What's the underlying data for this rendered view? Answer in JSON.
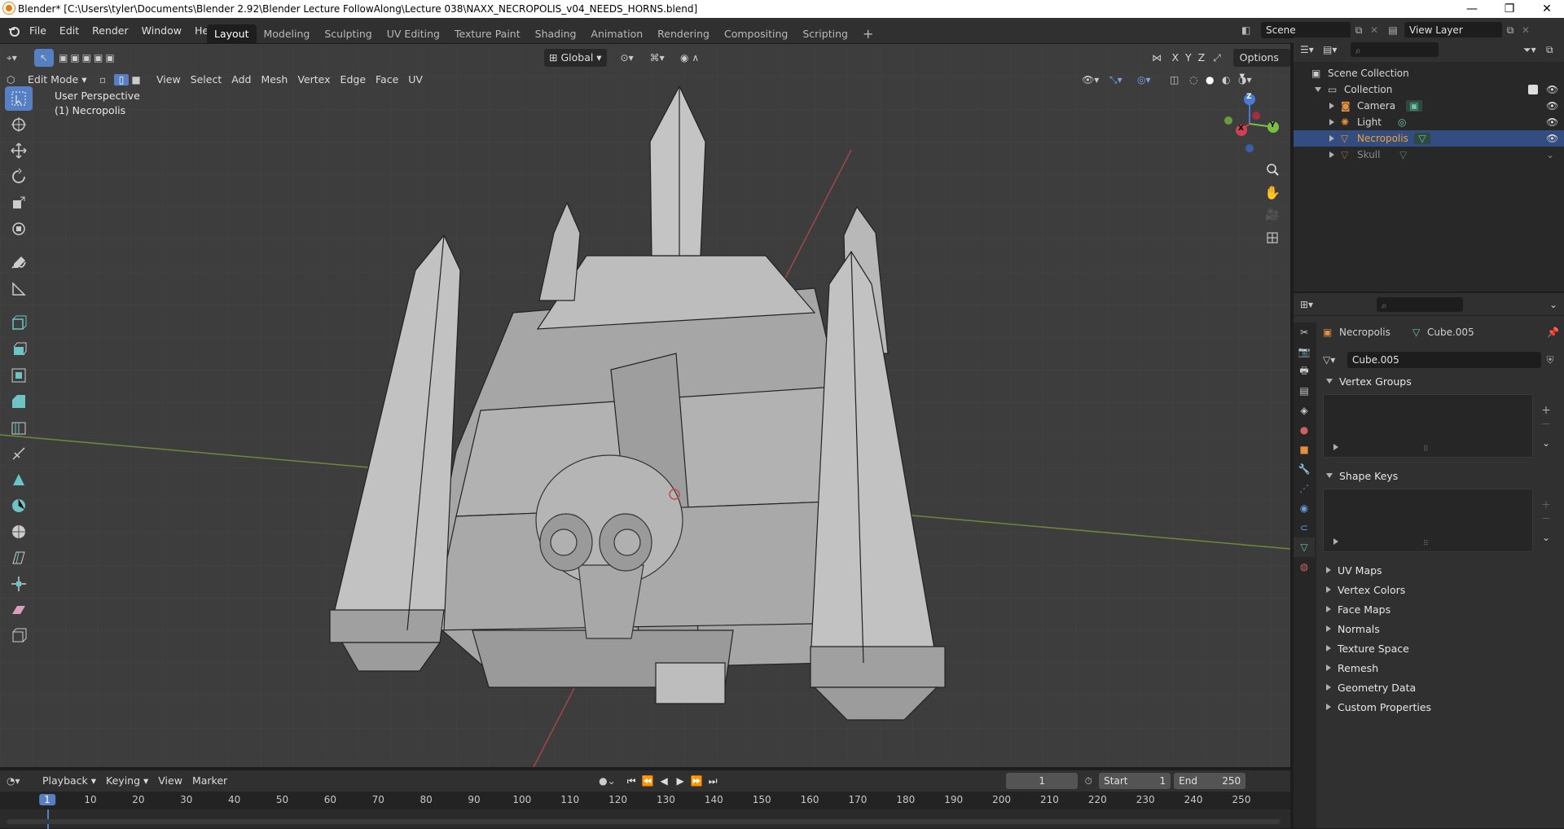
{
  "window": {
    "title": "Blender* [C:\\Users\\tyler\\Documents\\Blender 2.92\\Blender Lecture FollowAlong\\Lecture 038\\NAXX_NECROPOLIS_v04_NEEDS_HORNS.blend]",
    "minimize": "—",
    "restore": "❐",
    "close": "✕"
  },
  "menu": [
    "File",
    "Edit",
    "Render",
    "Window",
    "Help"
  ],
  "workspaces": [
    "Layout",
    "Modeling",
    "Sculpting",
    "UV Editing",
    "Texture Paint",
    "Shading",
    "Animation",
    "Rendering",
    "Compositing",
    "Scripting"
  ],
  "active_workspace": "Layout",
  "add_workspace": "+",
  "scene": {
    "name": "Scene",
    "view_layer": "View Layer"
  },
  "viewport": {
    "header": {
      "mode": "Edit Mode",
      "menus": [
        "View",
        "Select",
        "Add",
        "Mesh",
        "Vertex",
        "Edge",
        "Face",
        "UV"
      ],
      "transform_orientation": "Global",
      "options": "Options",
      "axes": [
        "X",
        "Y",
        "Z"
      ]
    },
    "overlay_text": {
      "perspective": "User Perspective",
      "object": "(1) Necropolis"
    },
    "gizmo": {
      "x": "X",
      "y": "Y",
      "z": "Z"
    }
  },
  "outliner": {
    "root": "Scene Collection",
    "collection": "Collection",
    "items": [
      {
        "name": "Camera",
        "color": "#e0e0e0",
        "icon": "camera-icon"
      },
      {
        "name": "Light",
        "color": "#e0e0e0",
        "icon": "light-icon"
      },
      {
        "name": "Necropolis",
        "color": "#f0a030",
        "icon": "mesh-icon",
        "selected": true
      },
      {
        "name": "Skull",
        "color": "#8a8a8a",
        "icon": "mesh-icon"
      }
    ]
  },
  "properties": {
    "object": "Necropolis",
    "mesh": "Cube.005",
    "data_name": "Cube.005",
    "panels_open": [
      "Vertex Groups",
      "Shape Keys"
    ],
    "panels_closed": [
      "UV Maps",
      "Vertex Colors",
      "Face Maps",
      "Normals",
      "Texture Space",
      "Remesh",
      "Geometry Data",
      "Custom Properties"
    ]
  },
  "timeline": {
    "menus": [
      "Playback",
      "Keying",
      "View",
      "Marker"
    ],
    "current_frame": "1",
    "start_label": "Start",
    "start": "1",
    "end_label": "End",
    "end": "250",
    "ruler": [
      "1",
      "10",
      "20",
      "30",
      "40",
      "50",
      "60",
      "70",
      "80",
      "90",
      "100",
      "110",
      "120",
      "130",
      "140",
      "150",
      "160",
      "170",
      "180",
      "190",
      "200",
      "210",
      "220",
      "230",
      "240",
      "250"
    ]
  },
  "colors": {
    "accent": "#5680c2",
    "selected_row": "#334d80",
    "active_object": "#f0a030",
    "viewport_bg": "#3d3d3d"
  }
}
